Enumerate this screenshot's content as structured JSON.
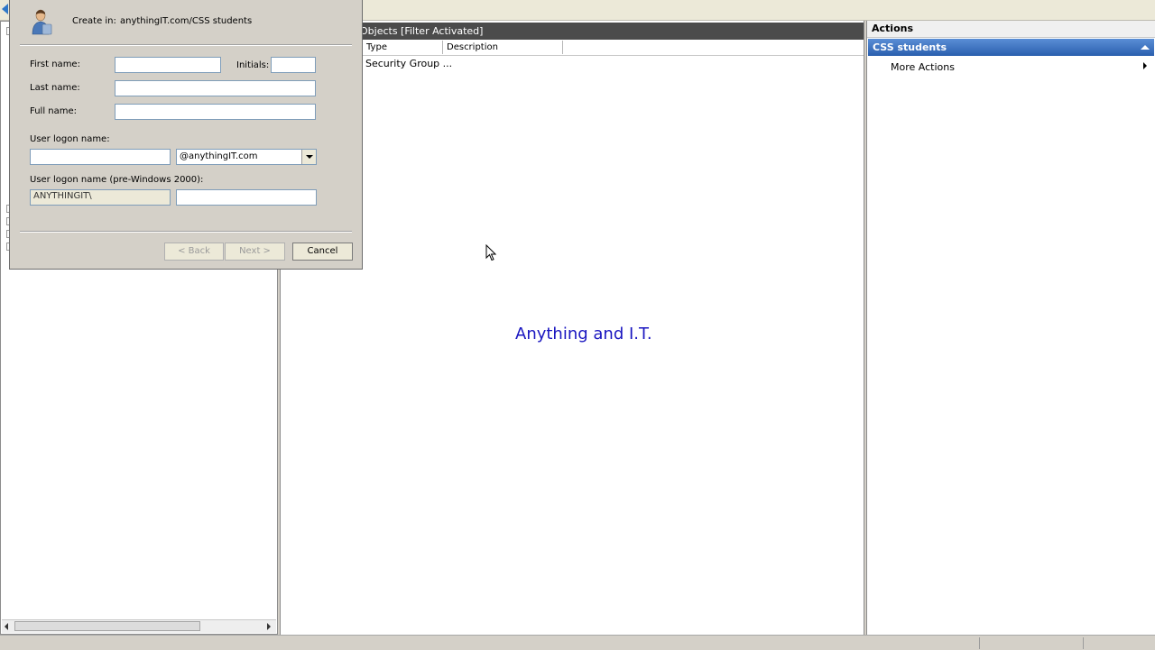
{
  "center": {
    "header_title": "Objects  [Filter Activated]",
    "columns": [
      "Type",
      "Description"
    ],
    "rows": [
      {
        "type": "Security Group ..."
      }
    ],
    "watermark": "Anything and I.T."
  },
  "actions": {
    "title": "Actions",
    "group": "CSS students",
    "items": [
      "More Actions"
    ]
  },
  "dialog": {
    "create_in_label": "Create in:",
    "create_in_path": "anythingIT.com/CSS students",
    "first_name_label": "First name:",
    "first_name_value": "",
    "initials_label": "Initials:",
    "initials_value": "",
    "last_name_label": "Last name:",
    "last_name_value": "",
    "full_name_label": "Full name:",
    "full_name_value": "",
    "logon_name_label": "User logon name:",
    "logon_name_value": "",
    "domain_suffix": "@anythingIT.com",
    "pre2000_label": "User logon name (pre-Windows 2000):",
    "pre2000_domain": "ANYTHINGIT\\",
    "pre2000_value": "",
    "back_button": "< Back",
    "next_button": "Next >",
    "cancel_button": "Cancel"
  },
  "icons": {
    "user": "user-icon",
    "back": "back-arrow-icon",
    "cursor": "mouse-cursor-icon"
  },
  "colors": {
    "watermark": "#1a16c0",
    "actions_header": "#2a5fae",
    "center_header": "#4b4b4b"
  }
}
